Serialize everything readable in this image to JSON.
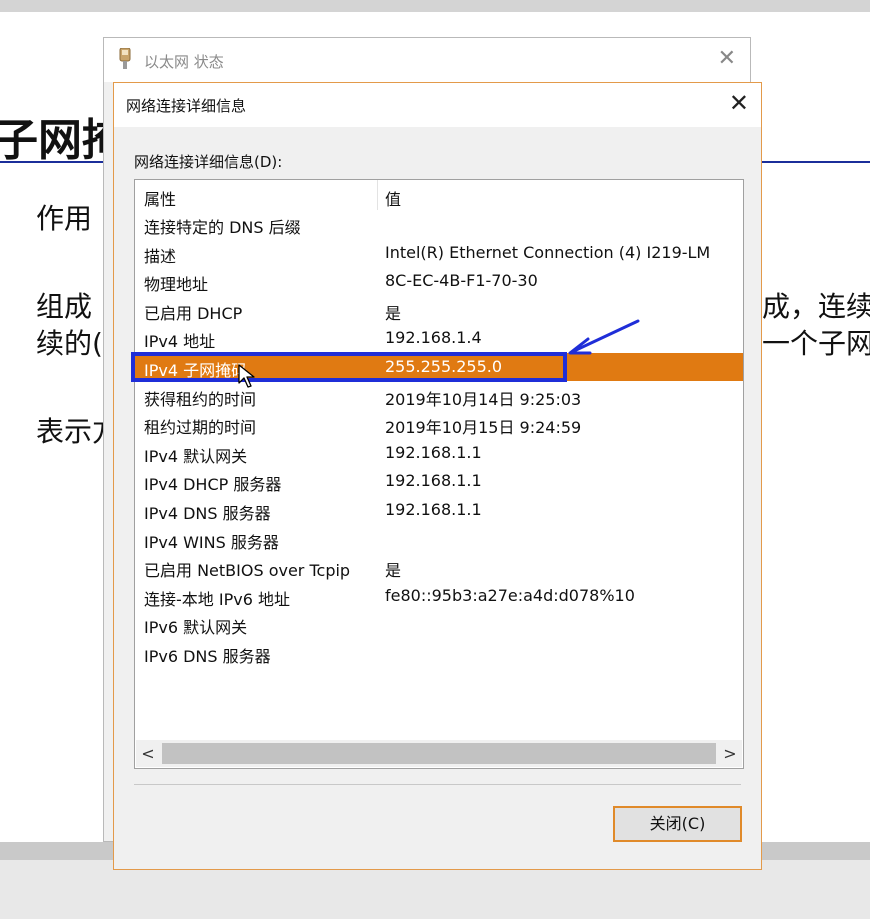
{
  "slide": {
    "title": "子网掩",
    "line1": "作用",
    "line2a": "组成",
    "line2b": "续的(",
    "line3": "表示方",
    "right1": "成，连续",
    "right2": "一个子网，"
  },
  "back_window": {
    "title": "以太网 状态",
    "close_glyph": "✕"
  },
  "dialog": {
    "title": "网络连接详细信息",
    "close_glyph": "✕",
    "list_label": "网络连接详细信息(D):",
    "columns": [
      "属性",
      "值"
    ],
    "rows": [
      {
        "property": "连接特定的 DNS 后缀",
        "value": ""
      },
      {
        "property": "描述",
        "value": "Intel(R) Ethernet Connection (4) I219-LM"
      },
      {
        "property": "物理地址",
        "value": "8C-EC-4B-F1-70-30"
      },
      {
        "property": "已启用 DHCP",
        "value": "是"
      },
      {
        "property": "IPv4 地址",
        "value": "192.168.1.4"
      },
      {
        "property": "IPv4 子网掩码",
        "value": "255.255.255.0"
      },
      {
        "property": "获得租约的时间",
        "value": "2019年10月14日 9:25:03"
      },
      {
        "property": "租约过期的时间",
        "value": "2019年10月15日 9:24:59"
      },
      {
        "property": "IPv4 默认网关",
        "value": "192.168.1.1"
      },
      {
        "property": "IPv4 DHCP 服务器",
        "value": "192.168.1.1"
      },
      {
        "property": "IPv4 DNS 服务器",
        "value": "192.168.1.1"
      },
      {
        "property": "IPv4 WINS 服务器",
        "value": ""
      },
      {
        "property": "已启用 NetBIOS over Tcpip",
        "value": "是"
      },
      {
        "property": "连接-本地 IPv6 地址",
        "value": "fe80::95b3:a27e:a4d:d078%10"
      },
      {
        "property": "IPv6 默认网关",
        "value": ""
      },
      {
        "property": "IPv6 DNS 服务器",
        "value": ""
      }
    ],
    "selected_row_index": 5,
    "scroll_left": "<",
    "scroll_right": ">",
    "close_button": "关闭(C)"
  },
  "colors": {
    "selection": "#e07a12",
    "annotation": "#1f2ed8",
    "accent_border": "#e39a4a"
  }
}
